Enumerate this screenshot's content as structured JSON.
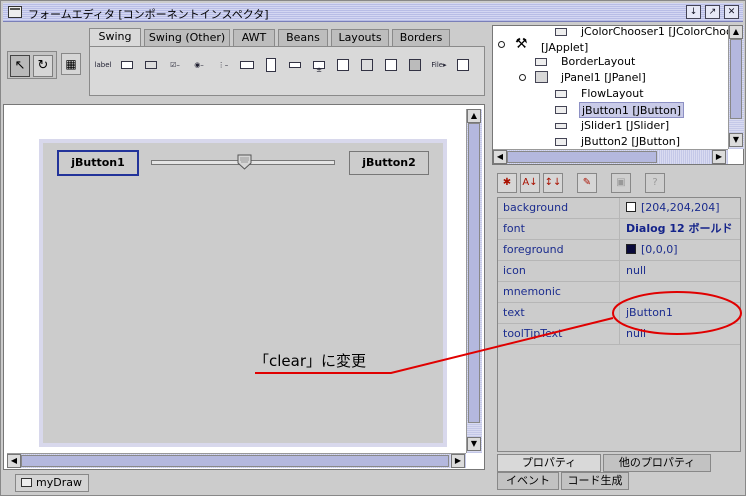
{
  "window": {
    "title": "フォームエディタ [コンポーネントインスペクタ]",
    "buttons": [
      "↓",
      "↗",
      "✕"
    ]
  },
  "palette": {
    "tabs": [
      "Swing",
      "Swing (Other)",
      "AWT",
      "Beans",
      "Layouts",
      "Borders"
    ],
    "active_tab": "Swing",
    "items": [
      "label",
      "btn",
      "tgl",
      "chk",
      "rad",
      "combo",
      "list",
      "txt",
      "fmt",
      "pass",
      "area",
      "pane",
      "file",
      "menu"
    ]
  },
  "form": {
    "button1": "jButton1",
    "button2": "jButton2"
  },
  "doc_tab": {
    "label": "myDraw"
  },
  "tree": {
    "nodes": [
      {
        "label": "jColorChooser1 [JColorChooser]"
      },
      {
        "label": "[JApplet]"
      },
      {
        "label": "BorderLayout"
      },
      {
        "label": "jPanel1 [JPanel]"
      },
      {
        "label": "FlowLayout"
      },
      {
        "label": "jButton1 [JButton]"
      },
      {
        "label": "jSlider1 [JSlider]"
      },
      {
        "label": "jButton2 [JButton]"
      }
    ],
    "selected": "jButton1 [JButton]"
  },
  "properties": {
    "rows": [
      {
        "name": "background",
        "value": "[204,204,204]",
        "swatch": "#ffffff"
      },
      {
        "name": "font",
        "value": "Dialog 12 ボールド",
        "bold": true
      },
      {
        "name": "foreground",
        "value": "[0,0,0]",
        "swatch": "#0a0a3a"
      },
      {
        "name": "icon",
        "value": "null"
      },
      {
        "name": "mnemonic",
        "value": ""
      },
      {
        "name": "text",
        "value": "jButton1"
      },
      {
        "name": "toolTipText",
        "value": "null"
      }
    ]
  },
  "bottom_tabs": {
    "row1": [
      "プロパティ",
      "他のプロパティ"
    ],
    "row2": [
      "イベント",
      "コード生成"
    ]
  },
  "annotation": {
    "text": "「clear」に変更",
    "color": "#e00000"
  }
}
